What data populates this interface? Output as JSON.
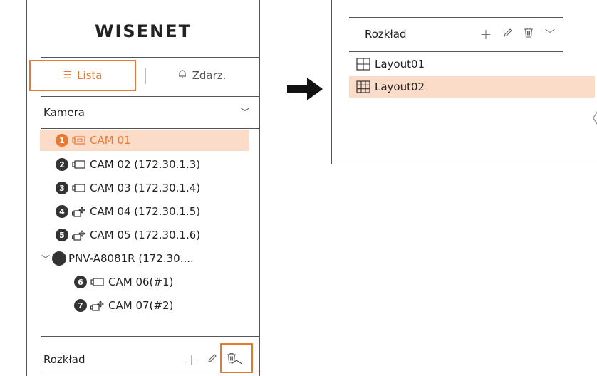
{
  "left_panel": {
    "logo": "WISENET",
    "tabs": [
      {
        "label": "Lista",
        "icon": "list-icon",
        "active": true
      },
      {
        "label": "Zdarz.",
        "icon": "bell-icon",
        "active": false
      }
    ],
    "camera_section": {
      "label": "Kamera",
      "toggle": "chevron-down-icon"
    },
    "cameras": [
      {
        "num": "1",
        "label": "CAM 01",
        "icon": "fixed-camera-icon",
        "selected": true
      },
      {
        "num": "2",
        "label": "CAM 02 (172.30.1.3)",
        "icon": "fixed-camera-icon",
        "selected": false
      },
      {
        "num": "3",
        "label": "CAM 03 (172.30.1.4)",
        "icon": "fixed-camera-icon",
        "selected": false
      },
      {
        "num": "4",
        "label": "CAM 04 (172.30.1.5)",
        "icon": "ptz-camera-icon",
        "selected": false
      },
      {
        "num": "5",
        "label": "CAM 05 (172.30.1.6)",
        "icon": "ptz-camera-icon",
        "selected": false
      }
    ],
    "group": {
      "label": "PNV-A8081R (172.30....",
      "children": [
        {
          "num": "6",
          "label": "CAM 06(#1)",
          "icon": "fixed-camera-icon"
        },
        {
          "num": "7",
          "label": "CAM 07(#2)",
          "icon": "ptz-camera-icon"
        }
      ]
    },
    "layout_section": {
      "label": "Rozkład",
      "collapse_icon": "chevron-up-icon"
    }
  },
  "right_panel": {
    "layout_section": {
      "label": "Rozkład",
      "expand_icon": "chevron-down-icon"
    },
    "layouts": [
      {
        "label": "Layout01",
        "icon": "grid-2x2-icon",
        "selected": false
      },
      {
        "label": "Layout02",
        "icon": "grid-3x3-icon",
        "selected": true
      }
    ],
    "side_toggle": "chevron-left-icon"
  },
  "colors": {
    "accent": "#e87933",
    "selected_bg": "#fadcc8",
    "badge": "#333333"
  },
  "glyphs": {
    "plus": "+",
    "chev_down": "﹀",
    "chev_up": "︿",
    "chev_small_down": "﹀",
    "side_chev": "〈",
    "list": "☰"
  }
}
